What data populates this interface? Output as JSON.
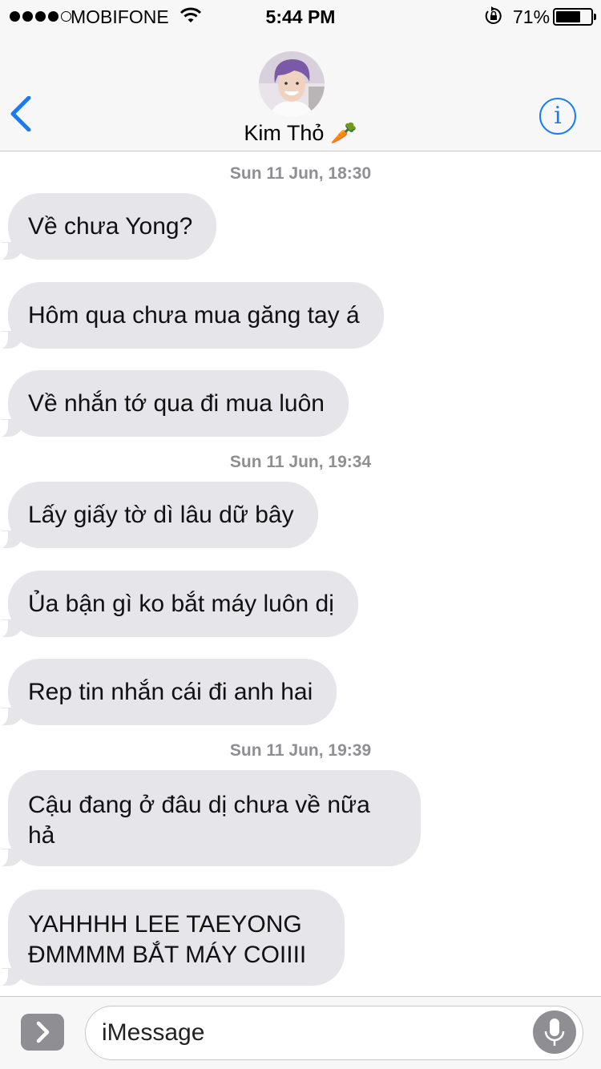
{
  "status_bar": {
    "carrier": "MOBIFONE",
    "time": "5:44 PM",
    "battery_percent": "71%",
    "battery_level": 0.71,
    "signal_bars": 4,
    "signal_total": 5
  },
  "header": {
    "contact_name": "Kim Thỏ 🥕"
  },
  "messages": [
    {
      "timestamp": "Sun 11 Jun, 18:30"
    },
    {
      "text": "Về chưa Yong?"
    },
    {
      "text": "Hôm qua chưa mua găng tay á"
    },
    {
      "text": "Về nhắn tớ qua đi mua luôn"
    },
    {
      "timestamp": "Sun 11 Jun, 19:34"
    },
    {
      "text": "Lấy giấy tờ dì lâu dữ bây"
    },
    {
      "text": "Ủa bận gì ko bắt máy luôn dị"
    },
    {
      "text": "Rep tin nhắn cái đi anh hai"
    },
    {
      "timestamp": "Sun 11 Jun, 19:39"
    },
    {
      "text": "Cậu đang ở đâu dị chưa về nữa hả"
    },
    {
      "text": "YAHHHH LEE TAEYONG ĐMMMM BẮT MÁY COIIII"
    }
  ],
  "input": {
    "placeholder": "iMessage"
  },
  "colors": {
    "accent": "#1a7cf5",
    "bubble_incoming": "#e5e5ea",
    "timestamp": "#8e8e93",
    "bar_background": "#f7f7f7"
  },
  "icons": [
    "signal-dots",
    "wifi-icon",
    "orientation-lock-icon",
    "battery-icon",
    "back-chevron-icon",
    "info-icon",
    "app-drawer-chevron-icon",
    "microphone-icon"
  ]
}
